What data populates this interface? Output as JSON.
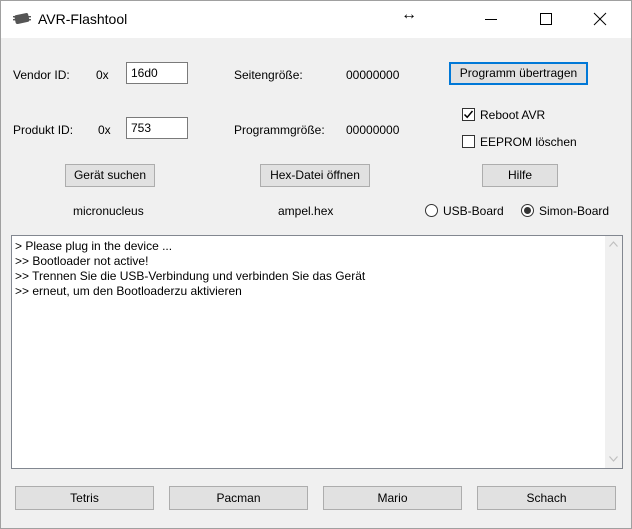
{
  "window": {
    "title": "AVR-Flashtool",
    "icons": {
      "app": "chip-icon",
      "drag": "left-right-arrow-icon",
      "minimize": "minimize-icon",
      "maximize": "maximize-icon",
      "close": "close-icon"
    },
    "drag_glyph": "↔"
  },
  "form": {
    "vendor_label": "Vendor ID:",
    "vendor_prefix": "0x",
    "vendor_value": "16d0",
    "product_label": "Produkt ID:",
    "product_prefix": "0x",
    "product_value": "753",
    "page_size_label": "Seitengröße:",
    "page_size_value": "00000000",
    "program_size_label": "Programmgröße:",
    "program_size_value": "00000000"
  },
  "buttons": {
    "upload": "Programm übertragen",
    "find_device": "Gerät suchen",
    "open_hex": "Hex-Datei öffnen",
    "help": "Hilfe"
  },
  "options": {
    "reboot_label": "Reboot AVR",
    "reboot_checked": true,
    "eeprom_label": "EEPROM löschen",
    "eeprom_checked": false,
    "board_options": [
      "USB-Board",
      "Simon-Board"
    ],
    "board_selected": "Simon-Board"
  },
  "status": {
    "device_name": "micronucleus",
    "hex_file": "ampel.hex"
  },
  "log": {
    "lines": [
      "> Please plug in the device ...",
      ">> Bootloader not active!",
      ">> Trennen Sie die USB-Verbindung und verbinden Sie das Gerät",
      ">> erneut, um den Bootloaderzu aktivieren"
    ]
  },
  "games": {
    "buttons": [
      "Tetris",
      "Pacman",
      "Mario",
      "Schach"
    ]
  },
  "colors": {
    "accent": "#0078d7",
    "window_bg": "#f0f0f0",
    "button_bg": "#e1e1e1"
  }
}
